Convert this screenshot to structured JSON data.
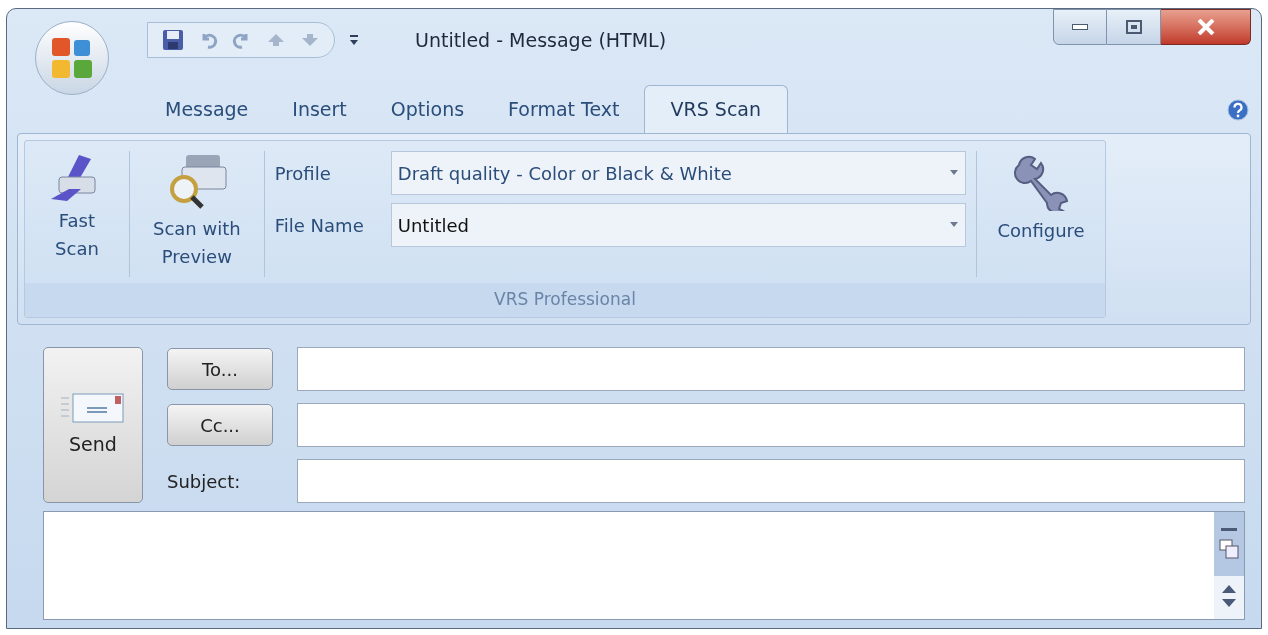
{
  "window": {
    "title": "Untitled - Message (HTML)"
  },
  "tabs": [
    {
      "label": "Message",
      "selected": false
    },
    {
      "label": "Insert",
      "selected": false
    },
    {
      "label": "Options",
      "selected": false
    },
    {
      "label": "Format Text",
      "selected": false
    },
    {
      "label": "VRS Scan",
      "selected": true
    }
  ],
  "ribbon": {
    "group_label": "VRS Professional",
    "fast_scan": "Fast Scan",
    "scan_preview": "Scan with Preview",
    "profile_label": "Profile",
    "profile_value": "Draft quality - Color or Black & White",
    "file_name_label": "File Name",
    "file_name_value": "Untitled",
    "configure": "Configure"
  },
  "form": {
    "send": "Send",
    "to": "To...",
    "cc": "Cc...",
    "subject_label": "Subject:"
  }
}
